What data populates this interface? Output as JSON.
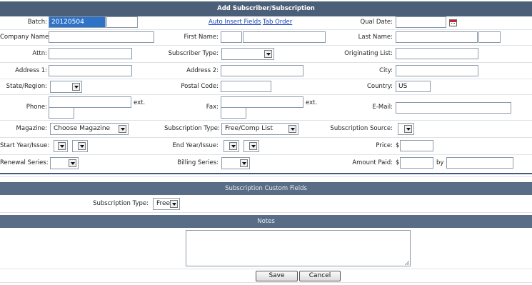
{
  "header": {
    "title": "Add Subscriber/Subscription"
  },
  "links": {
    "auto_insert": "Auto Insert Fields",
    "tab_order": "Tab Order"
  },
  "fields": {
    "batch": {
      "label": "Batch:",
      "value": "20120504",
      "value2": ""
    },
    "qual_date": {
      "label": "Qual Date:",
      "value": ""
    },
    "company_name": {
      "label": "Company Name:",
      "value": ""
    },
    "first_name": {
      "label": "First Name:",
      "value": "",
      "value2": ""
    },
    "last_name": {
      "label": "Last Name:",
      "value": "",
      "value2": ""
    },
    "attn": {
      "label": "Attn:",
      "value": ""
    },
    "subscriber_type": {
      "label": "Subscriber Type:",
      "value": ""
    },
    "originating_list": {
      "label": "Originating List:",
      "value": ""
    },
    "address1": {
      "label": "Address 1:",
      "value": ""
    },
    "address2": {
      "label": "Address 2:",
      "value": ""
    },
    "city": {
      "label": "City:",
      "value": ""
    },
    "state_region": {
      "label": "State/Region:",
      "value": ""
    },
    "postal_code": {
      "label": "Postal Code:",
      "value": ""
    },
    "country": {
      "label": "Country:",
      "value": "US"
    },
    "phone": {
      "label": "Phone:",
      "value": "",
      "ext_label": "ext.",
      "ext_value": ""
    },
    "fax": {
      "label": "Fax:",
      "value": "",
      "ext_label": "ext.",
      "ext_value": ""
    },
    "email": {
      "label": "E-Mail:",
      "value": ""
    },
    "magazine": {
      "label": "Magazine:",
      "value": "Choose Magazine"
    },
    "subscription_type": {
      "label": "Subscription Type:",
      "value": "Free/Comp List"
    },
    "subscription_source": {
      "label": "Subscription Source:",
      "value": ""
    },
    "start_year_issue": {
      "label": "Start Year/Issue:",
      "year": "",
      "issue": ""
    },
    "end_year_issue": {
      "label": "End Year/Issue:",
      "year": "",
      "issue": ""
    },
    "price": {
      "label": "Price:",
      "currency": "$",
      "value": ""
    },
    "renewal_series": {
      "label": "Renewal Series:",
      "value": ""
    },
    "billing_series": {
      "label": "Billing Series:",
      "value": ""
    },
    "amount_paid": {
      "label": "Amount Paid:",
      "currency": "$",
      "value": "",
      "by_label": "by",
      "by_value": ""
    }
  },
  "custom_fields": {
    "title": "Subscription Custom Fields",
    "subscription_type": {
      "label": "Subscription Type:",
      "value": "Free"
    }
  },
  "notes": {
    "title": "Notes",
    "value": ""
  },
  "buttons": {
    "save": "Save",
    "cancel": "Cancel"
  }
}
